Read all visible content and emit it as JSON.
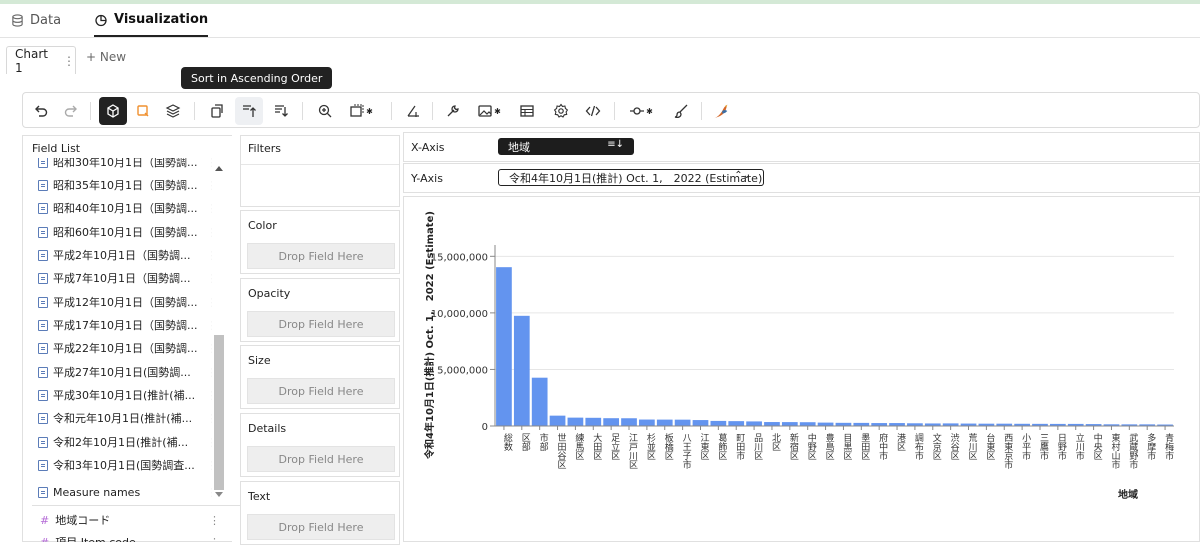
{
  "app": {
    "tabs": [
      {
        "label": "Data"
      },
      {
        "label": "Visualization"
      }
    ]
  },
  "chart_tabs": {
    "active": "Chart 1",
    "new": "+ New"
  },
  "tooltip": "Sort in Ascending Order",
  "toolbar": {
    "icons": [
      "undo-icon",
      "redo-icon",
      "cube-icon",
      "brush-select-icon",
      "layers-icon",
      "transpose-icon",
      "sort-ascending-icon",
      "sort-descending-icon",
      "zoom-icon",
      "resize-icon",
      "axis-icon",
      "wrench-icon",
      "image-icon",
      "table-icon",
      "settings-icon",
      "code-icon",
      "line-point-icon",
      "paint-icon",
      "bird-logo-icon"
    ]
  },
  "field_list": {
    "title": "Field List",
    "items": [
      {
        "label": "昭和30年10月1日（国勢調..."
      },
      {
        "label": "昭和35年10月1日（国勢調..."
      },
      {
        "label": "昭和40年10月1日（国勢調..."
      },
      {
        "label": "昭和60年10月1日（国勢調..."
      },
      {
        "label": "平成2年10月1日（国勢調..."
      },
      {
        "label": "平成7年10月1日（国勢調..."
      },
      {
        "label": "平成12年10月1日（国勢調..."
      },
      {
        "label": "平成17年10月1日（国勢調..."
      },
      {
        "label": "平成22年10月1日（国勢調..."
      },
      {
        "label": "平成27年10月1日(国勢調..."
      },
      {
        "label": "平成30年10月1日(推計(補..."
      },
      {
        "label": "令和元年10月1日(推計(補..."
      },
      {
        "label": "令和2年10月1日(推計(補..."
      },
      {
        "label": "令和3年10月1日(国勢調査..."
      },
      {
        "label": "Measure names"
      }
    ],
    "dimensions": [
      {
        "label": "地域コード"
      },
      {
        "label": "項目 Item code"
      }
    ]
  },
  "encodings": {
    "filters": "Filters",
    "color": "Color",
    "opacity": "Opacity",
    "size": "Size",
    "details": "Details",
    "text": "Text",
    "drop_placeholder": "Drop Field Here"
  },
  "axes": {
    "x_label": "X-Axis",
    "x_field": "地域",
    "y_label": "Y-Axis",
    "y_field": "令和4年10月1日(推計) Oct. 1,　2022 (Estimate)"
  },
  "colors": {
    "bar": "#6394ef",
    "pill_dark": "#1d1d1d"
  },
  "chart_data": {
    "type": "bar",
    "xlabel": "地域",
    "ylabel": "令和4年10月1日(推計) Oct. 1,　2022 (Estimate)",
    "ylim": [
      0,
      16000000
    ],
    "yticks": [
      0,
      5000000,
      10000000,
      15000000
    ],
    "ytick_labels": [
      "0",
      "5,000,000",
      "10,000,000",
      "15,000,000"
    ],
    "categories": [
      "総数",
      "区部",
      "市部",
      "世田谷区",
      "練馬区",
      "大田区",
      "足立区",
      "江戸川区",
      "杉並区",
      "板橋区",
      "八王子市",
      "江東区",
      "葛飾区",
      "町田市",
      "品川区",
      "北区",
      "新宿区",
      "中野区",
      "豊島区",
      "目黒区",
      "墨田区",
      "府中市",
      "港区",
      "調布市",
      "文京区",
      "渋谷区",
      "荒川区",
      "台東区",
      "西東京市",
      "小平市",
      "三鷹市",
      "日野市",
      "立川市",
      "中央区",
      "東村山市",
      "武蔵野市",
      "多摩市",
      "青梅市"
    ],
    "values": [
      14040000,
      9740000,
      4270000,
      915000,
      740000,
      725000,
      690000,
      685000,
      570000,
      565000,
      560000,
      525000,
      450000,
      430000,
      405000,
      350000,
      345000,
      335000,
      300000,
      280000,
      275000,
      260000,
      260000,
      240000,
      225000,
      230000,
      215000,
      205000,
      205000,
      195000,
      190000,
      185000,
      185000,
      170000,
      150000,
      145000,
      145000,
      130000
    ]
  }
}
